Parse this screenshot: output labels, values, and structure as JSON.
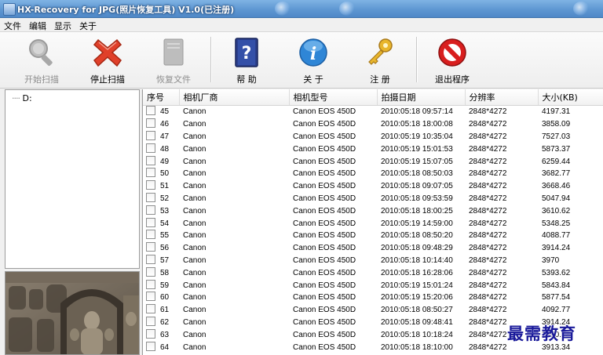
{
  "window": {
    "title": "HX-Recovery for JPG(照片恢复工具) V1.0(已注册)"
  },
  "menu": [
    "文件",
    "编辑",
    "显示",
    "关于"
  ],
  "toolbar": {
    "start_scan": "开始扫描",
    "stop_scan": "停止扫描",
    "recover_files": "恢复文件",
    "help": "帮 助",
    "about": "关 于",
    "register": "注 册",
    "exit": "退出程序"
  },
  "tree": {
    "root": "D:"
  },
  "table": {
    "columns": [
      "序号",
      "相机厂商",
      "相机型号",
      "拍摄日期",
      "分辨率",
      "大小(KB)"
    ],
    "rows": [
      [
        "45",
        "Canon",
        "Canon EOS 450D",
        "2010:05:18 09:57:14",
        "2848*4272",
        "4197.31"
      ],
      [
        "46",
        "Canon",
        "Canon EOS 450D",
        "2010:05:18 18:00:08",
        "2848*4272",
        "3858.09"
      ],
      [
        "47",
        "Canon",
        "Canon EOS 450D",
        "2010:05:19 10:35:04",
        "2848*4272",
        "7527.03"
      ],
      [
        "48",
        "Canon",
        "Canon EOS 450D",
        "2010:05:19 15:01:53",
        "2848*4272",
        "5873.37"
      ],
      [
        "49",
        "Canon",
        "Canon EOS 450D",
        "2010:05:19 15:07:05",
        "2848*4272",
        "6259.44"
      ],
      [
        "50",
        "Canon",
        "Canon EOS 450D",
        "2010:05:18 08:50:03",
        "2848*4272",
        "3682.77"
      ],
      [
        "51",
        "Canon",
        "Canon EOS 450D",
        "2010:05:18 09:07:05",
        "2848*4272",
        "3668.46"
      ],
      [
        "52",
        "Canon",
        "Canon EOS 450D",
        "2010:05:18 09:53:59",
        "2848*4272",
        "5047.94"
      ],
      [
        "53",
        "Canon",
        "Canon EOS 450D",
        "2010:05:18 18:00:25",
        "2848*4272",
        "3610.62"
      ],
      [
        "54",
        "Canon",
        "Canon EOS 450D",
        "2010:05:19 14:59:00",
        "2848*4272",
        "5348.25"
      ],
      [
        "55",
        "Canon",
        "Canon EOS 450D",
        "2010:05:18 08:50:20",
        "2848*4272",
        "4088.77"
      ],
      [
        "56",
        "Canon",
        "Canon EOS 450D",
        "2010:05:18 09:48:29",
        "2848*4272",
        "3914.24"
      ],
      [
        "57",
        "Canon",
        "Canon EOS 450D",
        "2010:05:18 10:14:40",
        "2848*4272",
        "3970"
      ],
      [
        "58",
        "Canon",
        "Canon EOS 450D",
        "2010:05:18 16:28:06",
        "2848*4272",
        "5393.62"
      ],
      [
        "59",
        "Canon",
        "Canon EOS 450D",
        "2010:05:19 15:01:24",
        "2848*4272",
        "5843.84"
      ],
      [
        "60",
        "Canon",
        "Canon EOS 450D",
        "2010:05:19 15:20:06",
        "2848*4272",
        "5877.54"
      ],
      [
        "61",
        "Canon",
        "Canon EOS 450D",
        "2010:05:18 08:50:27",
        "2848*4272",
        "4092.77"
      ],
      [
        "62",
        "Canon",
        "Canon EOS 450D",
        "2010:05:18 09:48:41",
        "2848*4272",
        "3914.24"
      ],
      [
        "63",
        "Canon",
        "Canon EOS 450D",
        "2010:05:18 10:18:24",
        "2848*4272",
        "3990.58"
      ],
      [
        "64",
        "Canon",
        "Canon EOS 450D",
        "2010:05:18 18:10:00",
        "2848*4272",
        "3913.34"
      ]
    ]
  },
  "watermark": "最需教育",
  "icons": {
    "start_scan": "magnifier-icon",
    "stop_scan": "red-x-icon",
    "recover_files": "recover-file-icon",
    "help": "help-book-icon",
    "about": "info-icon",
    "register": "key-icon",
    "exit": "no-entry-icon"
  },
  "colors": {
    "titlebar": "#5e97d2",
    "stop_red": "#e0402a",
    "exit_red": "#d81e1e",
    "info_blue": "#2f86d6",
    "key_gold": "#e8b62c",
    "watermark": "#1a1a9a"
  }
}
